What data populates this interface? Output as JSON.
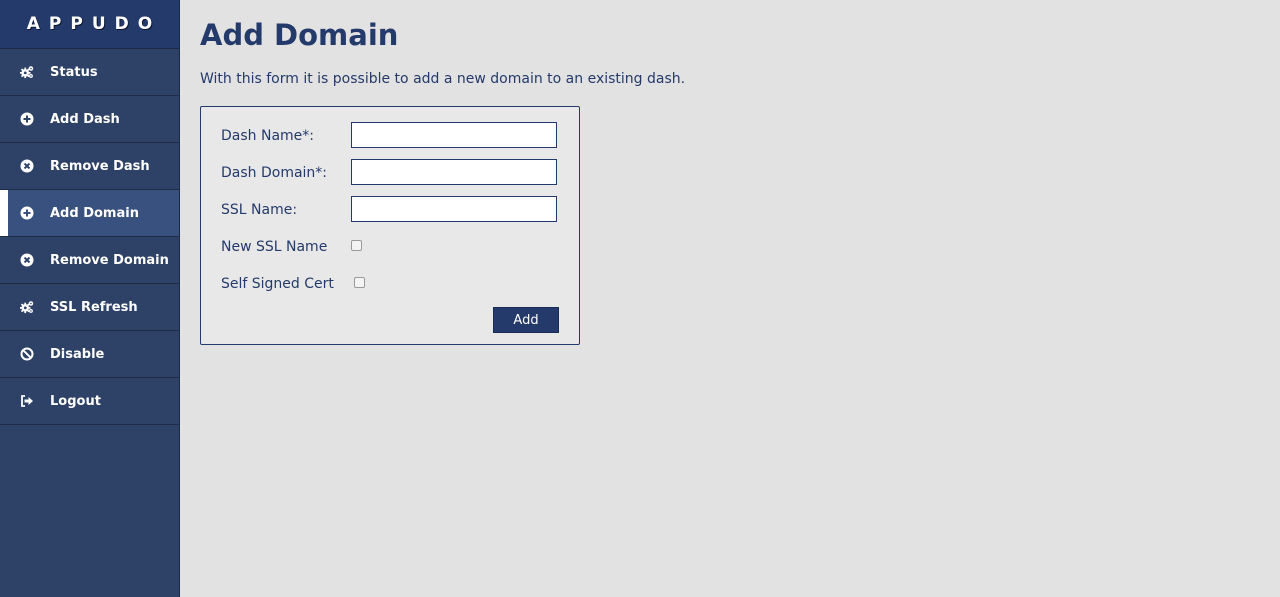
{
  "sidebar": {
    "brand": "APPUDO",
    "items": [
      {
        "label": "Status",
        "icon": "cogs-icon"
      },
      {
        "label": "Add Dash",
        "icon": "plus-circle-icon"
      },
      {
        "label": "Remove Dash",
        "icon": "times-circle-icon"
      },
      {
        "label": "Add Domain",
        "icon": "plus-circle-icon",
        "active": true
      },
      {
        "label": "Remove Domain",
        "icon": "times-circle-icon"
      },
      {
        "label": "SSL Refresh",
        "icon": "cogs-icon"
      },
      {
        "label": "Disable",
        "icon": "ban-icon"
      },
      {
        "label": "Logout",
        "icon": "sign-out-icon"
      }
    ]
  },
  "main": {
    "title": "Add Domain",
    "description": "With this form it is possible to add a new domain to an existing dash.",
    "form": {
      "dash_name_label": "Dash Name*:",
      "dash_name_value": "",
      "dash_domain_label": "Dash Domain*:",
      "dash_domain_value": "",
      "ssl_name_label": "SSL Name:",
      "ssl_name_value": "",
      "new_ssl_label": "New SSL Name",
      "new_ssl_checked": false,
      "self_signed_label": "Self Signed Cert",
      "self_signed_checked": false,
      "submit_label": "Add"
    }
  },
  "colors": {
    "sidebar_bg": "#2e4166",
    "sidebar_active_bg": "#39517e",
    "brand_bg": "#243a6a",
    "accent": "#243a6a",
    "page_bg": "#e2e2e2"
  }
}
